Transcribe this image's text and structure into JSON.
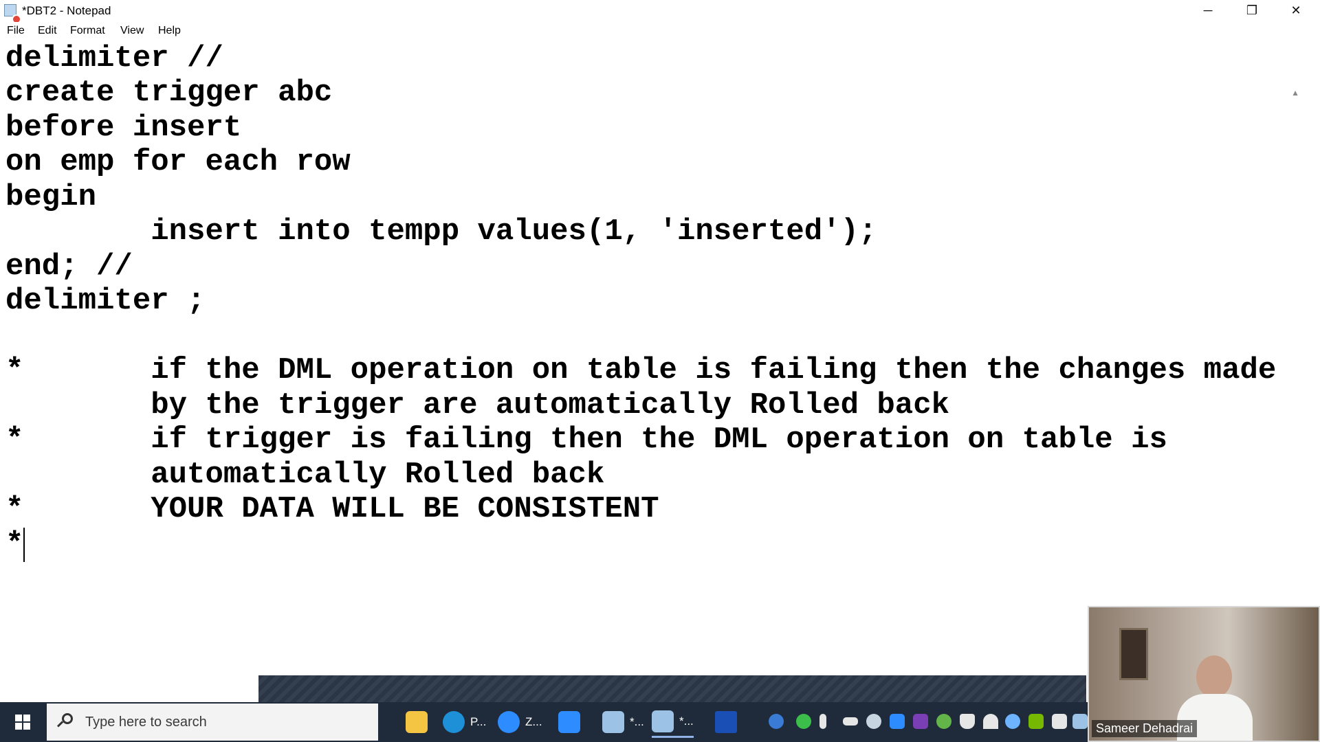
{
  "window": {
    "title": "*DBT2 - Notepad",
    "minimize_glyph": "─",
    "restore_glyph": "❐",
    "close_glyph": "✕"
  },
  "menu": [
    "File",
    "Edit",
    "Format",
    "View",
    "Help"
  ],
  "editor": {
    "lines": [
      "delimiter //",
      "create trigger abc",
      "before insert",
      "on emp for each row",
      "begin",
      "        insert into tempp values(1, 'inserted');",
      "end; //",
      "delimiter ;",
      "",
      "*       if the DML operation on table is failing then the changes made",
      "        by the trigger are automatically Rolled back",
      "*       if trigger is failing then the DML operation on table is",
      "        automatically Rolled back",
      "*       YOUR DATA WILL BE CONSISTENT",
      "*"
    ]
  },
  "taskbar": {
    "search_placeholder": "Type here to search",
    "apps": [
      {
        "name": "file-explorer-icon",
        "label": "",
        "color": "#f4c542"
      },
      {
        "name": "edge-icon",
        "label": "P...",
        "color": "#1e90d8"
      },
      {
        "name": "zoom-icon",
        "label": "Z...",
        "color": "#2d8cff"
      },
      {
        "name": "zoom-meeting-icon",
        "label": "",
        "color": "#2d8cff"
      },
      {
        "name": "notepad-icon",
        "label": "*...",
        "color": "#9cc3e6"
      },
      {
        "name": "notepad-active-icon",
        "label": "*...",
        "color": "#9cc3e6"
      },
      {
        "name": "stock-chart-icon",
        "label": "",
        "color": "#1a4fb5"
      }
    ],
    "tray_icons": [
      {
        "name": "help-icon",
        "color": "#3a7bd5"
      },
      {
        "name": "check-shield-icon",
        "color": "#3cbf4a"
      },
      {
        "name": "microphone-icon",
        "color": "#e6e6e6"
      },
      {
        "name": "battery-icon",
        "color": "#e6e6e6"
      },
      {
        "name": "steam-icon",
        "color": "#c7d5e0"
      },
      {
        "name": "zoom-tray-icon",
        "color": "#2d8cff"
      },
      {
        "name": "onenote-icon",
        "color": "#7b3fb5"
      },
      {
        "name": "update-icon",
        "color": "#63b54a"
      },
      {
        "name": "defender-icon",
        "color": "#e6e6e6"
      },
      {
        "name": "wifi-icon",
        "color": "#e6e6e6"
      },
      {
        "name": "snowflake-icon",
        "color": "#6db3ff"
      },
      {
        "name": "nvidia-icon",
        "color": "#76b900"
      },
      {
        "name": "display-icon",
        "color": "#e6e6e6"
      },
      {
        "name": "network-icon",
        "color": "#9cc3e6"
      }
    ]
  },
  "webcam": {
    "participant_name": "Sameer Dehadrai"
  }
}
